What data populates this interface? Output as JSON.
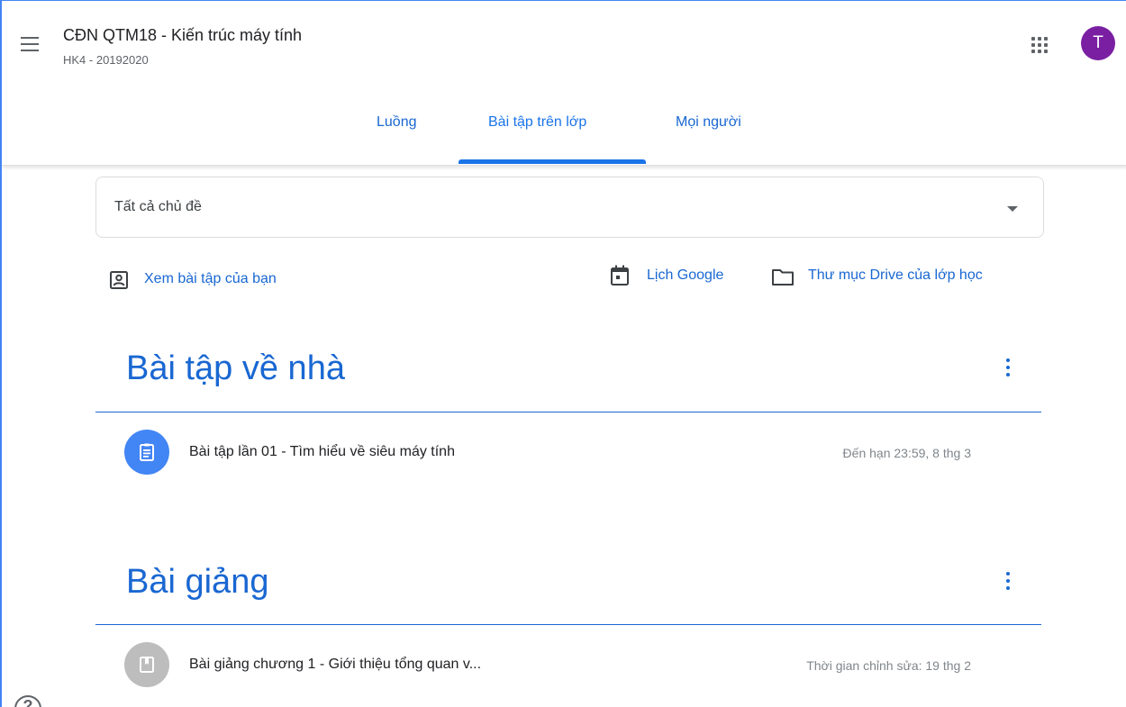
{
  "header": {
    "title": "CĐN QTM18 - Kiến trúc máy tính",
    "subtitle": "HK4 - 20192020",
    "avatar_letter": "T",
    "tabs": [
      {
        "label": "Luồng"
      },
      {
        "label": "Bài tập trên lớp"
      },
      {
        "label": "Mọi người"
      }
    ]
  },
  "topic_filter": {
    "selected": "Tất cả chủ đề"
  },
  "links": {
    "view_work": "Xem bài tập của bạn",
    "calendar": "Lịch Google",
    "drive": "Thư mục Drive của lớp học"
  },
  "sections": [
    {
      "title": "Bài tập về nhà",
      "items": [
        {
          "title": "Bài tập lần 01 - Tìm hiểu về siêu máy tính",
          "meta": "Đến hạn 23:59, 8 thg 3"
        }
      ]
    },
    {
      "title": "Bài giảng",
      "items": [
        {
          "title": "Bài giảng chương 1 - Giới thiệu tổng quan v...",
          "meta": "Thời gian chỉnh sửa: 19 thg 2"
        }
      ]
    }
  ],
  "colors": {
    "accent": "#1967d2",
    "avatar": "#7b1fa2",
    "assignment_icon": "#4285f4",
    "material_icon": "#bdbdbd"
  }
}
